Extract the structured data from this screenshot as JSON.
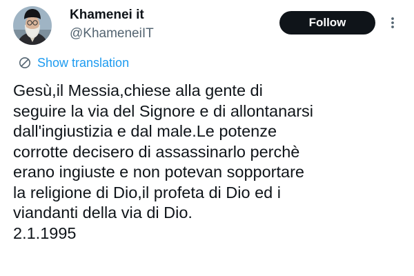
{
  "author": {
    "name": "Khamenei it",
    "handle": "@KhameneiIT",
    "avatar_icon": "profile-portrait"
  },
  "actions": {
    "follow_label": "Follow",
    "more_icon": "more-vertical-icon"
  },
  "translation": {
    "label": "Show translation",
    "icon": "globe-icon"
  },
  "tweet": {
    "lines": [
      "Gesù,il Messia,chiese alla gente di",
      "seguire la via del Signore e di allontanarsi",
      "dall'ingiustizia e dal male.Le potenze",
      "corrotte decisero di assassinarlo perchè",
      "erano ingiuste e non potevan sopportare",
      "la religione di Dio,il profeta di Dio ed i",
      "viandanti della via di Dio.",
      "2.1.1995"
    ]
  },
  "colors": {
    "text_primary": "#0f1419",
    "text_secondary": "#536471",
    "accent": "#1d9bf0",
    "button_bg": "#0f1419",
    "button_text": "#ffffff"
  }
}
